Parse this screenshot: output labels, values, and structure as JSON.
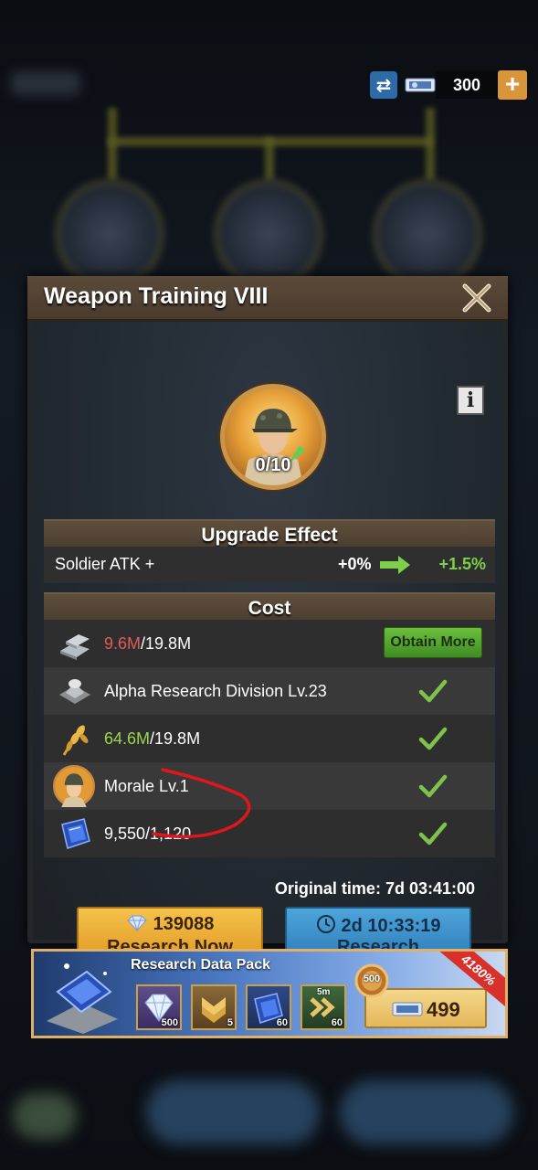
{
  "topbar": {
    "currency_value": "300",
    "icons": [
      "swap-icon",
      "ticket-icon",
      "plus-icon"
    ]
  },
  "dialog": {
    "title": "Weapon Training VIII",
    "avatar_level": "0/10",
    "info_label": "i",
    "upgrade_effect": {
      "header": "Upgrade Effect",
      "label": "Soldier ATK +",
      "from": "+0%",
      "to": "+1.5%"
    },
    "cost": {
      "header": "Cost",
      "rows": [
        {
          "icon": "steel-icon",
          "have": "9.6M",
          "need": "/19.8M",
          "status": "insufficient",
          "action": "Obtain More"
        },
        {
          "icon": "building-icon",
          "text": "Alpha Research Division Lv.23",
          "status": "met"
        },
        {
          "icon": "food-icon",
          "have": "64.6M",
          "need": "/19.8M",
          "status": "met"
        },
        {
          "icon": "morale-icon",
          "text": "Morale Lv.1",
          "status": "met"
        },
        {
          "icon": "data-chip-icon",
          "text": "9,550/1,120",
          "status": "met"
        }
      ]
    },
    "original_time": "Original time: 7d 03:41:00",
    "research_now": {
      "gems": "139088",
      "label": "Research Now"
    },
    "research": {
      "time": "2d 10:33:19",
      "label": "Research"
    }
  },
  "pack": {
    "title": "Research Data Pack",
    "ribbon": "4180%",
    "medal_value": "500",
    "items": [
      {
        "icon": "diamond-icon",
        "count": "500"
      },
      {
        "icon": "rank-badge-icon",
        "count": "5"
      },
      {
        "icon": "data-chip-icon",
        "count": "60"
      },
      {
        "icon": "speedup-icon",
        "count": "60",
        "badge": "5m"
      }
    ],
    "price": "499"
  },
  "colors": {
    "dialog_header": "#5b4a39",
    "gold_button": "#f5c24a",
    "blue_button": "#4ea5da",
    "red_value": "#e25b5b",
    "green_value": "#9ad64c",
    "annotation_red": "#e0161b"
  }
}
